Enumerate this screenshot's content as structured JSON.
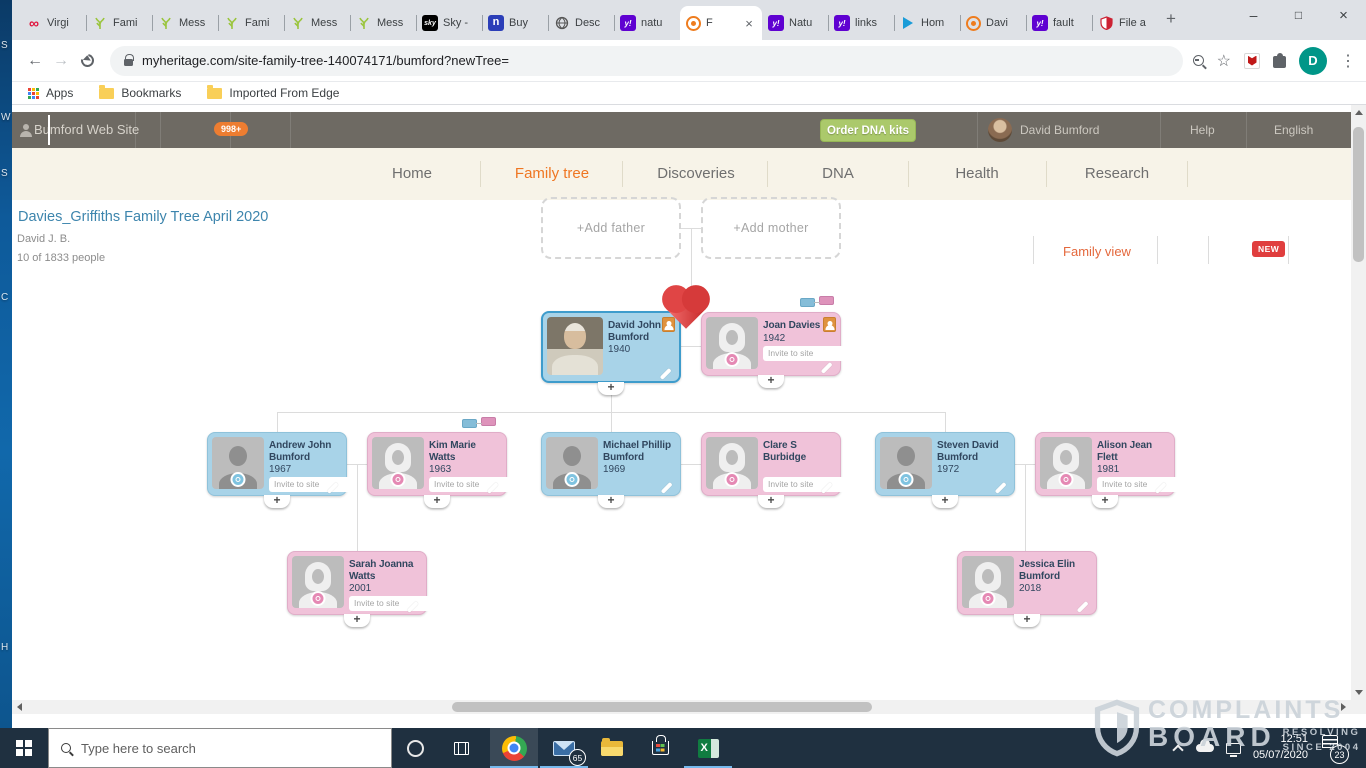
{
  "browser": {
    "tabs": [
      {
        "label": "Virgi",
        "icon": "virgin-icon"
      },
      {
        "label": "Fami",
        "icon": "branch-icon"
      },
      {
        "label": "Mess",
        "icon": "branch-icon"
      },
      {
        "label": "Fami",
        "icon": "branch-icon"
      },
      {
        "label": "Mess",
        "icon": "branch-icon"
      },
      {
        "label": "Mess",
        "icon": "branch-icon"
      },
      {
        "label": "Sky -",
        "icon": "sky-icon"
      },
      {
        "label": "Buy",
        "icon": "nectar-icon"
      },
      {
        "label": "Desc",
        "icon": "globe-icon"
      },
      {
        "label": "natu",
        "icon": "yahoo-icon"
      },
      {
        "label": "F",
        "icon": "myheritage-icon",
        "active": true
      },
      {
        "label": "Natu",
        "icon": "yahoo-icon"
      },
      {
        "label": "links",
        "icon": "yahoo-icon"
      },
      {
        "label": "Hom",
        "icon": "arrow-icon"
      },
      {
        "label": "Davi",
        "icon": "myheritage-icon"
      },
      {
        "label": "fault",
        "icon": "yahoo-icon"
      },
      {
        "label": "File a",
        "icon": "shield-icon"
      }
    ],
    "toolbar": {
      "url": "myheritage.com/site-family-tree-140074171/bumford?newTree=",
      "profile_initial": "D"
    },
    "bookmarks_bar": {
      "apps_label": "Apps",
      "folder_labels": [
        "Bookmarks",
        "Imported From Edge"
      ]
    }
  },
  "myheritage": {
    "header": {
      "site_name": "Bumford Web Site",
      "notification_badge": "998+",
      "order_dna_button": "Order DNA kits",
      "user_name": "David Bumford",
      "help_label": "Help",
      "language_label": "English"
    },
    "nav": {
      "items": [
        "Home",
        "Family tree",
        "Discoveries",
        "DNA",
        "Health",
        "Research"
      ],
      "active": "Family tree"
    },
    "tree_info": {
      "title": "Davies_Griffiths Family Tree April 2020",
      "manager": "David J. B.",
      "people_count": "10 of 1833 people"
    },
    "view_bar": {
      "family_view_label": "Family view",
      "new_badge": "NEW"
    },
    "tree": {
      "add_father_label": "+Add father",
      "add_mother_label": "+Add mother",
      "invite_label": "Invite to site",
      "people": [
        {
          "name": "David John Bumford",
          "year": "1940"
        },
        {
          "name": "Joan Davies",
          "year": "1942"
        },
        {
          "name": "Andrew John Bumford",
          "year": "1967"
        },
        {
          "name": "Kim Marie Watts",
          "year": "1963"
        },
        {
          "name": "Michael Phillip Bumford",
          "year": "1969"
        },
        {
          "name": "Clare S Burbidge",
          "year": ""
        },
        {
          "name": "Steven David Bumford",
          "year": "1972"
        },
        {
          "name": "Alison Jean Flett",
          "year": "1981"
        },
        {
          "name": "Sarah Joanna Watts",
          "year": "2001"
        },
        {
          "name": "Jessica Elin Bumford",
          "year": "2018"
        }
      ]
    }
  },
  "taskbar": {
    "search_placeholder": "Type here to search",
    "mail_badge": "65",
    "time": "12:51",
    "date": "05/07/2020",
    "notification_count": "23"
  },
  "watermark": {
    "line1": "COMPLAINTS",
    "line2": "BOARD",
    "tagline1": "RESOLVING",
    "tagline2": "SINCE 2004"
  }
}
